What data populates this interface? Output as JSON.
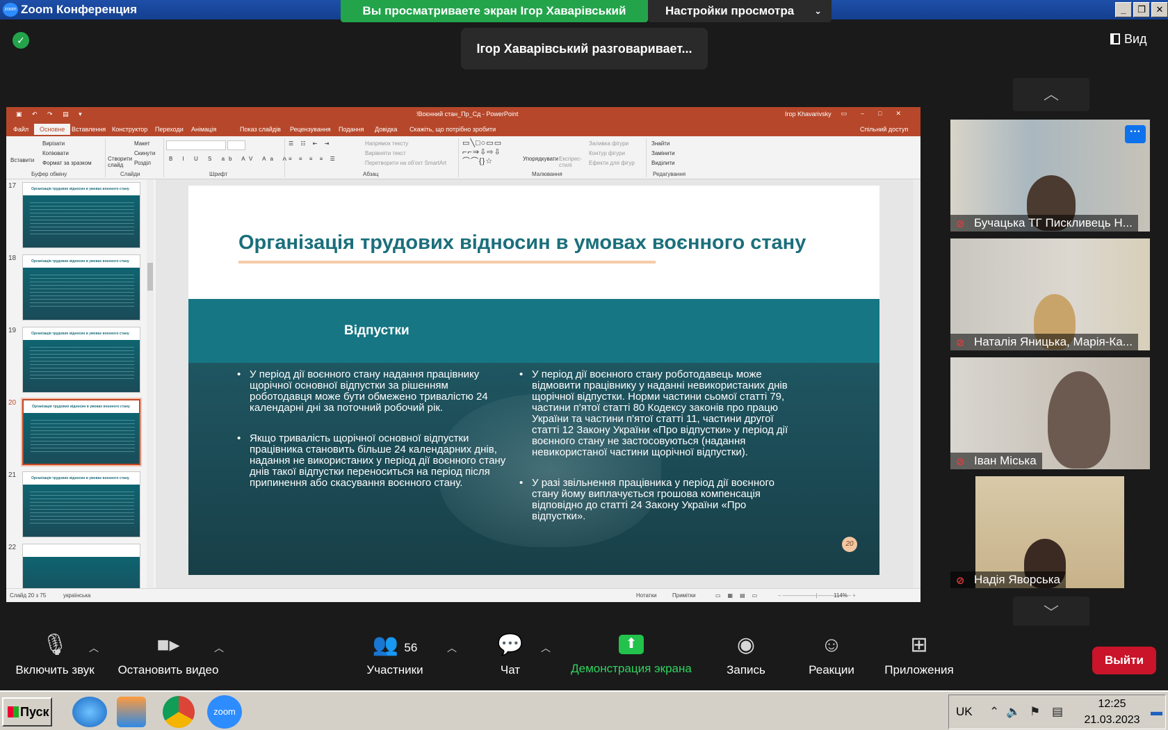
{
  "zoom": {
    "app_title": "Zoom Конференция",
    "share_banner": "Вы просматриваете экран Ігор Хаварівський",
    "view_settings": "Настройки просмотра",
    "talking": "Ігор Хаварівський разговаривает...",
    "view_label": "Вид",
    "logo_text": "zoom"
  },
  "ppt": {
    "doc_title": "!Воєнний стан_Пр_Сд  -  PowerPoint",
    "user": "Ігор Khavarivsky",
    "tabs": [
      "Файл",
      "Основне",
      "Вставлення",
      "Конструктор",
      "Переходи",
      "Анімація",
      "Показ слайдів",
      "Рецензування",
      "Подання",
      "Довідка",
      "Скажіть, що потрібно зробити",
      "Спільний доступ"
    ],
    "ribbon": {
      "paste": "Вставити",
      "cut": "Вирізати",
      "copy": "Копіювати",
      "format_painter": "Формат за зразком",
      "new_slide": "Створити слайд",
      "layout": "Макет",
      "reset": "Скинути",
      "section": "Розділ",
      "text_direction": "Напрямок тексту",
      "align_text": "Вирівняти текст",
      "smartart": "Перетворити на об'єкт SmartArt",
      "arrange": "Упорядкувати",
      "quick_styles": "Експрес-стилі",
      "shape_fill": "Заливка фігури",
      "shape_outline": "Контур фігури",
      "shape_effects": "Ефекти для фігур",
      "find": "Знайти",
      "replace": "Замінити",
      "select": "Виділити",
      "groups": [
        "Буфер обміну",
        "Слайди",
        "Шрифт",
        "Абзац",
        "Малювання",
        "Редагування"
      ]
    },
    "thumbnails": [
      {
        "num": "17",
        "title": "Організація трудових відносин в умовах воєнного стану"
      },
      {
        "num": "18",
        "title": "Організація трудових відносин в умовах воєнного стану"
      },
      {
        "num": "19",
        "title": "Організація трудових відносин в умовах воєнного стану"
      },
      {
        "num": "20",
        "title": "Організація трудових відносин в умовах воєнного стану"
      },
      {
        "num": "21",
        "title": "Організація трудових відносин в умовах воєнного стану"
      },
      {
        "num": "22",
        "title": ""
      }
    ],
    "slide": {
      "title": "Організація трудових відносин в умовах воєнного стану",
      "subtitle": "Відпустки",
      "left_bullets": [
        "У період дії воєнного стану надання працівнику щорічної основної відпустки за рішенням роботодавця може бути обмежено тривалістю 24 календарні дні за поточний робочий рік.",
        "Якщо тривалість щорічної основної відпустки працівника становить більше 24 календарних днів, надання не використаних у період дії воєнного стану днів такої відпустки переноситься на період після припинення або скасування воєнного стану."
      ],
      "right_bullets": [
        "У період дії воєнного стану роботодавець може відмовити працівнику у наданні невикористаних днів щорічної відпустки. Норми частини сьомої статті 79, частини п'ятої статті 80 Кодексу законів про працю України та частини п'ятої статті 11, частини другої статті 12 Закону України «Про відпустки» у період дії воєнного стану не застосовуються (надання невикористаної частини щорічної відпустки).",
        "У разі звільнення працівника у період дії воєнного стану йому виплачується грошова компенсація відповідно до статті 24 Закону України «Про відпустки»."
      ],
      "page_number": "20"
    },
    "status": {
      "slide_of": "Слайд 20 з 75",
      "language": "українська",
      "notes": "Нотатки",
      "comments": "Примітки",
      "zoom": "114%"
    }
  },
  "participants": [
    {
      "name": "Бучацька ТГ Пискливець Н..."
    },
    {
      "name": "Наталія Яницька, Марія-Ка..."
    },
    {
      "name": "Іван Міська"
    },
    {
      "name": "Надія Яворська"
    }
  ],
  "toolbar": {
    "unmute": "Включить звук",
    "stop_video": "Остановить видео",
    "participants": "Участники",
    "participants_count": "56",
    "chat": "Чат",
    "share": "Демонстрация экрана",
    "record": "Запись",
    "reactions": "Реакции",
    "apps": "Приложения",
    "leave": "Выйти"
  },
  "taskbar": {
    "start": "Пуск",
    "lang": "UK",
    "time": "12:25",
    "date": "21.03.2023",
    "zoom_app": "zoom"
  },
  "colors": {
    "zoom_green": "#23a44b",
    "ppt_accent": "#b7472a",
    "slide_teal": "#167683",
    "leave_red": "#c9142a"
  }
}
